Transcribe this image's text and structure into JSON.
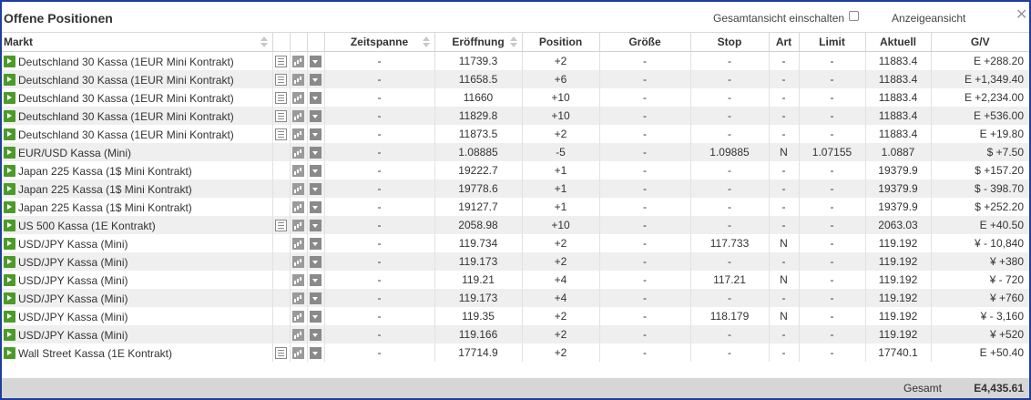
{
  "window": {
    "title": "Offene Positionen",
    "overall_view_label": "Gesamtansicht einschalten",
    "overall_view_checked": false,
    "view_mode_label": "Anzeigeansicht",
    "close_icon": "close-icon",
    "frame_color": "#1e3e9e"
  },
  "columns": {
    "market": "Markt",
    "timespan": "Zeitspanne",
    "opening": "Eröffnung",
    "position": "Position",
    "size": "Größe",
    "stop": "Stop",
    "type": "Art",
    "limit": "Limit",
    "current": "Aktuell",
    "pnl": "G/V"
  },
  "colors": {
    "positive": "#1a94d2",
    "negative": "#d9342b",
    "play_icon": "#4c9a2a",
    "row_alt": "#efefef",
    "footer_bg": "#d6d6d6"
  },
  "rows": [
    {
      "market": "Deutschland 30 Kassa (1EUR Mini Kontrakt)",
      "doc": true,
      "timespan": "-",
      "opening": "11739.3",
      "position": "+2",
      "pos_neg": false,
      "size": "-",
      "stop": "-",
      "type": "-",
      "limit": "-",
      "current": "11883.4",
      "pnl": "E +288.20",
      "pnl_neg": false
    },
    {
      "market": "Deutschland 30 Kassa (1EUR Mini Kontrakt)",
      "doc": true,
      "timespan": "-",
      "opening": "11658.5",
      "position": "+6",
      "pos_neg": false,
      "size": "-",
      "stop": "-",
      "type": "-",
      "limit": "-",
      "current": "11883.4",
      "pnl": "E +1,349.40",
      "pnl_neg": false
    },
    {
      "market": "Deutschland 30 Kassa (1EUR Mini Kontrakt)",
      "doc": true,
      "timespan": "-",
      "opening": "11660",
      "position": "+10",
      "pos_neg": false,
      "size": "-",
      "stop": "-",
      "type": "-",
      "limit": "-",
      "current": "11883.4",
      "pnl": "E +2,234.00",
      "pnl_neg": false
    },
    {
      "market": "Deutschland 30 Kassa (1EUR Mini Kontrakt)",
      "doc": true,
      "timespan": "-",
      "opening": "11829.8",
      "position": "+10",
      "pos_neg": false,
      "size": "-",
      "stop": "-",
      "type": "-",
      "limit": "-",
      "current": "11883.4",
      "pnl": "E +536.00",
      "pnl_neg": false
    },
    {
      "market": "Deutschland 30 Kassa (1EUR Mini Kontrakt)",
      "doc": true,
      "timespan": "-",
      "opening": "11873.5",
      "position": "+2",
      "pos_neg": false,
      "size": "-",
      "stop": "-",
      "type": "-",
      "limit": "-",
      "current": "11883.4",
      "pnl": "E +19.80",
      "pnl_neg": false
    },
    {
      "market": "EUR/USD Kassa (Mini)",
      "doc": false,
      "timespan": "-",
      "opening": "1.08885",
      "position": "-5",
      "pos_neg": true,
      "size": "-",
      "stop": "1.09885",
      "type": "N",
      "limit": "1.07155",
      "current": "1.0887",
      "pnl": "$ +7.50",
      "pnl_neg": false
    },
    {
      "market": "Japan 225 Kassa (1$ Mini Kontrakt)",
      "doc": false,
      "timespan": "-",
      "opening": "19222.7",
      "position": "+1",
      "pos_neg": false,
      "size": "-",
      "stop": "-",
      "type": "-",
      "limit": "-",
      "current": "19379.9",
      "pnl": "$ +157.20",
      "pnl_neg": false
    },
    {
      "market": "Japan 225 Kassa (1$ Mini Kontrakt)",
      "doc": false,
      "timespan": "-",
      "opening": "19778.6",
      "position": "+1",
      "pos_neg": false,
      "size": "-",
      "stop": "-",
      "type": "-",
      "limit": "-",
      "current": "19379.9",
      "pnl": "$ - 398.70",
      "pnl_neg": true
    },
    {
      "market": "Japan 225 Kassa (1$ Mini Kontrakt)",
      "doc": false,
      "timespan": "-",
      "opening": "19127.7",
      "position": "+1",
      "pos_neg": false,
      "size": "-",
      "stop": "-",
      "type": "-",
      "limit": "-",
      "current": "19379.9",
      "pnl": "$ +252.20",
      "pnl_neg": false
    },
    {
      "market": "US 500 Kassa (1E Kontrakt)",
      "doc": true,
      "timespan": "-",
      "opening": "2058.98",
      "position": "+10",
      "pos_neg": false,
      "size": "-",
      "stop": "-",
      "type": "-",
      "limit": "-",
      "current": "2063.03",
      "pnl": "E +40.50",
      "pnl_neg": false
    },
    {
      "market": "USD/JPY Kassa (Mini)",
      "doc": false,
      "timespan": "-",
      "opening": "119.734",
      "position": "+2",
      "pos_neg": false,
      "size": "-",
      "stop": "117.733",
      "type": "N",
      "limit": "-",
      "current": "119.192",
      "pnl": "¥ - 10,840",
      "pnl_neg": true
    },
    {
      "market": "USD/JPY Kassa (Mini)",
      "doc": false,
      "timespan": "-",
      "opening": "119.173",
      "position": "+2",
      "pos_neg": false,
      "size": "-",
      "stop": "-",
      "type": "-",
      "limit": "-",
      "current": "119.192",
      "pnl": "¥ +380",
      "pnl_neg": false
    },
    {
      "market": "USD/JPY Kassa (Mini)",
      "doc": false,
      "timespan": "-",
      "opening": "119.21",
      "position": "+4",
      "pos_neg": false,
      "size": "-",
      "stop": "117.21",
      "type": "N",
      "limit": "-",
      "current": "119.192",
      "pnl": "¥ - 720",
      "pnl_neg": true
    },
    {
      "market": "USD/JPY Kassa (Mini)",
      "doc": false,
      "timespan": "-",
      "opening": "119.173",
      "position": "+4",
      "pos_neg": false,
      "size": "-",
      "stop": "-",
      "type": "-",
      "limit": "-",
      "current": "119.192",
      "pnl": "¥ +760",
      "pnl_neg": false
    },
    {
      "market": "USD/JPY Kassa (Mini)",
      "doc": false,
      "timespan": "-",
      "opening": "119.35",
      "position": "+2",
      "pos_neg": false,
      "size": "-",
      "stop": "118.179",
      "type": "N",
      "limit": "-",
      "current": "119.192",
      "pnl": "¥ - 3,160",
      "pnl_neg": true
    },
    {
      "market": "USD/JPY Kassa (Mini)",
      "doc": false,
      "timespan": "-",
      "opening": "119.166",
      "position": "+2",
      "pos_neg": false,
      "size": "-",
      "stop": "-",
      "type": "-",
      "limit": "-",
      "current": "119.192",
      "pnl": "¥ +520",
      "pnl_neg": false
    },
    {
      "market": "Wall Street Kassa (1E Kontrakt)",
      "doc": true,
      "timespan": "-",
      "opening": "17714.9",
      "position": "+2",
      "pos_neg": false,
      "size": "-",
      "stop": "-",
      "type": "-",
      "limit": "-",
      "current": "17740.1",
      "pnl": "E +50.40",
      "pnl_neg": false
    }
  ],
  "footer": {
    "total_label": "Gesamt",
    "total_value": "E4,435.61"
  }
}
